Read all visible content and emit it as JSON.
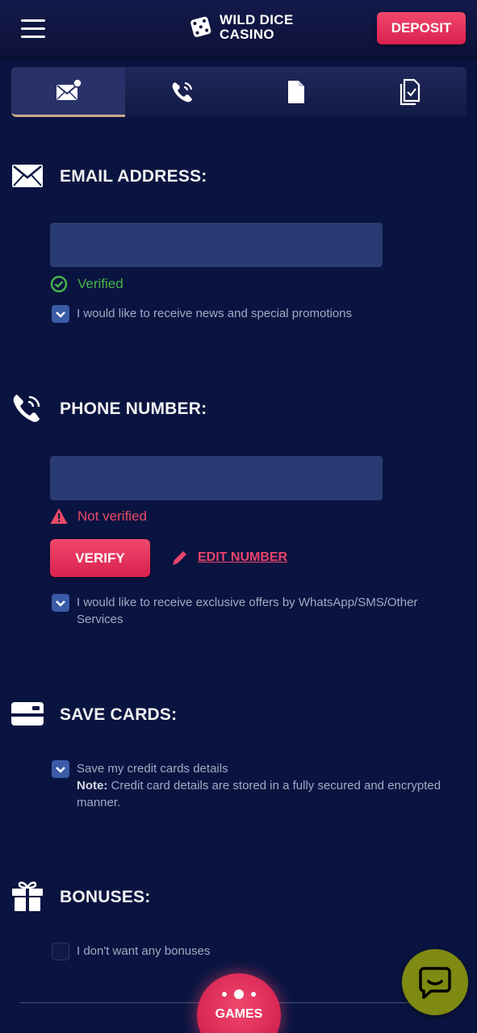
{
  "header": {
    "logo_line1": "WILD DICE",
    "logo_line2": "CASINO",
    "deposit_label": "DEPOSIT"
  },
  "tabs": [
    {
      "name": "email-tab",
      "icon": "envelope-user-icon",
      "active": true
    },
    {
      "name": "phone-tab",
      "icon": "phone-icon",
      "active": false
    },
    {
      "name": "document-tab",
      "icon": "document-icon",
      "active": false
    },
    {
      "name": "checklist-tab",
      "icon": "document-check-icon",
      "active": false
    }
  ],
  "email": {
    "title": "EMAIL ADDRESS:",
    "value": "",
    "status": "Verified",
    "checkbox_label": "I would like to receive news and special promotions",
    "checkbox_checked": true
  },
  "phone": {
    "title": "PHONE NUMBER:",
    "value": "",
    "status": "Not verified",
    "verify_label": "VERIFY",
    "edit_label": "EDIT NUMBER",
    "checkbox_label": "I would like to receive exclusive offers by WhatsApp/SMS/Other Services",
    "checkbox_checked": true
  },
  "cards": {
    "title": "SAVE CARDS:",
    "checkbox_label": "Save my credit cards details",
    "note_label": "Note:",
    "note_text": "Credit card details are stored in a fully secured and encrypted manner.",
    "checkbox_checked": true
  },
  "bonuses": {
    "title": "BONUSES:",
    "checkbox_label": "I don't want any bonuses",
    "checkbox_checked": false
  },
  "bottom": {
    "games_label": "GAMES"
  },
  "colors": {
    "background": "#0a1440",
    "accent": "#e8446b",
    "verified": "#46b34a",
    "chat": "#7f8a12"
  }
}
